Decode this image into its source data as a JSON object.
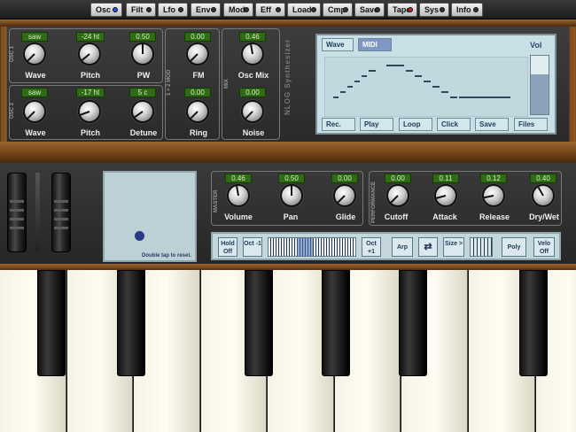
{
  "topbar": {
    "tabs": [
      {
        "label": "Osc",
        "led": "blue"
      },
      {
        "label": "Filt",
        "led": "off"
      },
      {
        "label": "Lfo",
        "led": "off"
      },
      {
        "label": "Env",
        "led": "off"
      },
      {
        "label": "Mod",
        "led": "off"
      },
      {
        "label": "Eff",
        "led": "off"
      },
      {
        "label": "Load",
        "led": "off"
      },
      {
        "label": "Cmp",
        "led": "off"
      },
      {
        "label": "Save",
        "led": "off"
      },
      {
        "label": "Tape",
        "led": "red"
      },
      {
        "label": "Sys",
        "led": "off"
      },
      {
        "label": "Info",
        "led": "off"
      }
    ]
  },
  "osc1": {
    "side_label": "OSC 1",
    "wave": {
      "value": "saw",
      "label": "Wave"
    },
    "pitch": {
      "value": "-24 ht",
      "label": "Pitch"
    },
    "pw": {
      "value": "0.50",
      "label": "PW"
    }
  },
  "osc2": {
    "side_label": "OSC 2",
    "wave": {
      "value": "saw",
      "label": "Wave"
    },
    "pitch": {
      "value": "-17 ht",
      "label": "Pitch"
    },
    "detune": {
      "value": "5 c",
      "label": "Detune"
    }
  },
  "mod": {
    "side_label": "1 > 2 MOD",
    "fm": {
      "value": "0.00",
      "label": "FM"
    },
    "ring": {
      "value": "0.00",
      "label": "Ring"
    }
  },
  "mix": {
    "side_label": "MIX",
    "osc_mix": {
      "value": "0.46",
      "label": "Osc Mix"
    },
    "noise": {
      "value": "0.00",
      "label": "Noise"
    }
  },
  "brand": "NLOG Synthesizer",
  "display": {
    "tab_wave": "Wave",
    "tab_midi": "MIDI",
    "vol_label": "Vol",
    "vol_level": 0.68,
    "buttons": [
      "Rec.",
      "Play",
      "Loop",
      "Click",
      "Save",
      "Files"
    ]
  },
  "xypad": {
    "hint": "Double tap to reset."
  },
  "master": {
    "side_label": "MASTER",
    "volume": {
      "value": "0.46",
      "label": "Volume"
    },
    "pan": {
      "value": "0.50",
      "label": "Pan"
    },
    "glide": {
      "value": "0.00",
      "label": "Glide"
    }
  },
  "performance": {
    "side_label": "PERFORMANCE",
    "cutoff": {
      "value": "0.00",
      "label": "Cutoff"
    },
    "attack": {
      "value": "0.11",
      "label": "Attack"
    },
    "release": {
      "value": "0.12",
      "label": "Release"
    },
    "drywet": {
      "value": "0.40",
      "label": "Dry/Wet"
    }
  },
  "strip": {
    "hold": "Hold Off",
    "oct_down": "Oct -1",
    "oct_up": "Oct +1",
    "arp": "Arp",
    "size": "Size >",
    "poly": "Poly",
    "velo": "Velo Off"
  }
}
